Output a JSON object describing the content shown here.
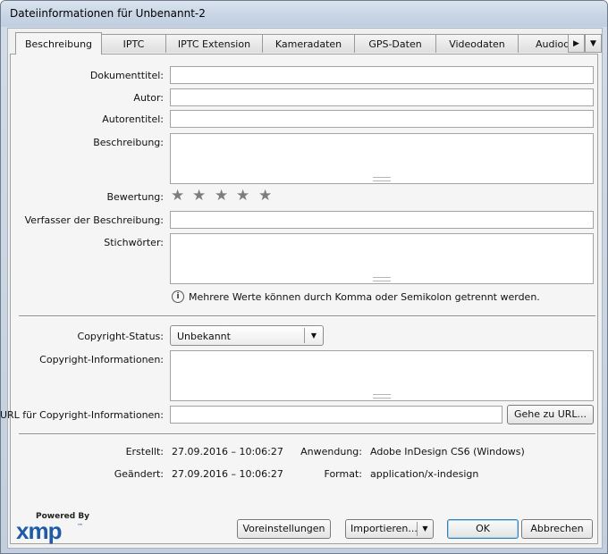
{
  "window": {
    "title": "Dateiinformationen für Unbenannt-2"
  },
  "tabs": [
    {
      "label": "Beschreibung"
    },
    {
      "label": "IPTC"
    },
    {
      "label": "IPTC Extension"
    },
    {
      "label": "Kameradaten"
    },
    {
      "label": "GPS-Daten"
    },
    {
      "label": "Videodaten"
    },
    {
      "label": "Audioda"
    }
  ],
  "tab_nav": {
    "scroll_glyph": "▶",
    "menu_glyph": "▼"
  },
  "form": {
    "document_title_label": "Dokumenttitel:",
    "document_title_value": "",
    "author_label": "Autor:",
    "author_value": "",
    "author_title_label": "Autorentitel:",
    "author_title_value": "",
    "description_label": "Beschreibung:",
    "description_value": "",
    "rating_label": "Bewertung:",
    "rating_value": 0,
    "rating_max": 5,
    "description_writer_label": "Verfasser der Beschreibung:",
    "description_writer_value": "",
    "keywords_label": "Stichwörter:",
    "keywords_value": "",
    "keywords_hint": "Mehrere Werte können durch Komma oder Semikolon getrennt werden.",
    "copyright_status_label": "Copyright-Status:",
    "copyright_status_value": "Unbekannt",
    "copyright_info_label": "Copyright-Informationen:",
    "copyright_info_value": "",
    "copyright_url_label": "URL für Copyright-Informationen:",
    "copyright_url_value": "",
    "go_to_url_label": "Gehe zu URL..."
  },
  "meta": {
    "created_label": "Erstellt:",
    "created_value": "27.09.2016 – 10:06:27",
    "modified_label": "Geändert:",
    "modified_value": "27.09.2016 – 10:06:27",
    "application_label": "Anwendung:",
    "application_value": "Adobe InDesign CS6 (Windows)",
    "format_label": "Format:",
    "format_value": "application/x-indesign"
  },
  "footer": {
    "powered_by": "Powered By",
    "xmp_logo": "xmp",
    "xmp_tm": "™",
    "preferences_label": "Voreinstellungen",
    "import_label": "Importieren...",
    "ok_label": "OK",
    "cancel_label": "Abbrechen"
  },
  "colors": {
    "xmp_blue": "#1e5aa8",
    "star_gray": "#7d7d7d",
    "panel_bg": "#f5f5f5"
  },
  "icons": {
    "info": "info-circle-icon",
    "star": "star-icon",
    "dropdown": "chevron-down-icon"
  }
}
